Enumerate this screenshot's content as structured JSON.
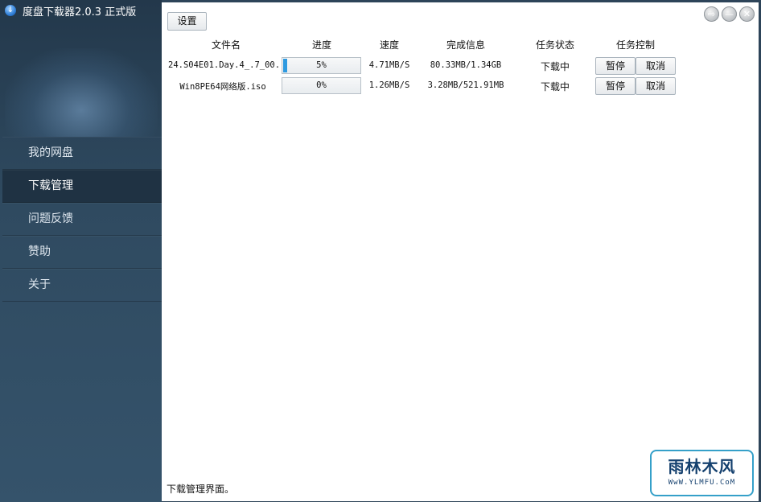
{
  "app": {
    "title": "度盘下载器2.0.3 正式版",
    "icon": "download-arrow-icon"
  },
  "sidebar": {
    "items": [
      {
        "label": "我的网盘",
        "active": false
      },
      {
        "label": "下载管理",
        "active": true
      },
      {
        "label": "问题反馈",
        "active": false
      },
      {
        "label": "赞助",
        "active": false
      },
      {
        "label": "关于",
        "active": false
      }
    ]
  },
  "toolbar": {
    "settings_label": "设置"
  },
  "window_controls": {
    "exit": "⇨",
    "minimize": "—",
    "close": "✕"
  },
  "table": {
    "headers": {
      "filename": "文件名",
      "progress": "进度",
      "speed": "速度",
      "info": "完成信息",
      "status": "任务状态",
      "control": "任务控制"
    },
    "rows": [
      {
        "filename": "24.S04E01.Day.4_.7_00.",
        "progress": 5,
        "progress_label": "5%",
        "speed": "4.71MB/S",
        "info": "80.33MB/1.34GB",
        "status": "下载中",
        "pause": "暂停",
        "cancel": "取消"
      },
      {
        "filename": "Win8PE64网络版.iso",
        "progress": 0,
        "progress_label": "0%",
        "speed": "1.26MB/S",
        "info": "3.28MB/521.91MB",
        "status": "下载中",
        "pause": "暂停",
        "cancel": "取消"
      }
    ]
  },
  "status_bar": {
    "text": "下载管理界面。"
  },
  "watermark": {
    "logo_text": "雨林木风",
    "url": "WwW.YLMFU.CoM"
  },
  "colors": {
    "accent": "#2f9ae0",
    "sidebar": "#2d4459",
    "active_item": "#1f3243",
    "watermark_border": "#35a0c9"
  }
}
